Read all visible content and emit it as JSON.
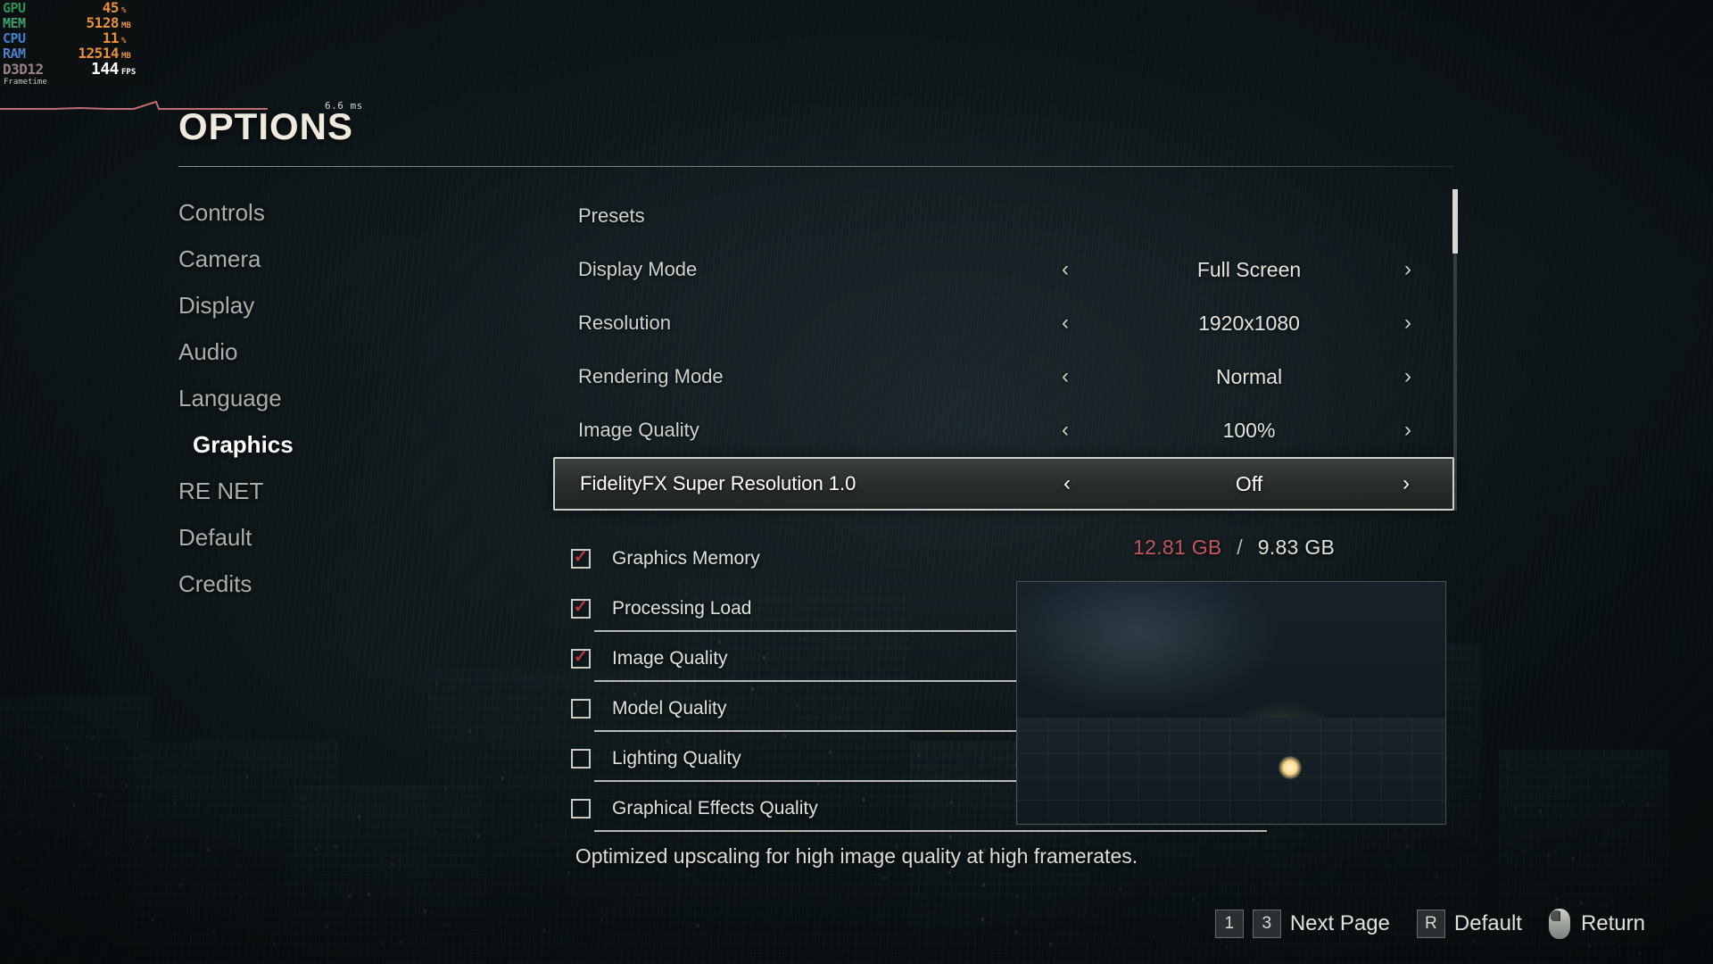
{
  "perf_overlay": {
    "rows": [
      {
        "label": "GPU",
        "value": "45",
        "unit": "%",
        "label_color": "#2f8f5b"
      },
      {
        "label": "MEM",
        "value": "5128",
        "unit": "MB",
        "label_color": "#3f9e6a"
      },
      {
        "label": "CPU",
        "value": "11",
        "unit": "%",
        "label_color": "#3f7fd0"
      },
      {
        "label": "RAM",
        "value": "12514",
        "unit": "MB",
        "label_color": "#4f7fc8"
      },
      {
        "label": "D3D12",
        "value": "144",
        "unit": "FPS",
        "label_color": "#9a7f86"
      }
    ],
    "frametime_label": "Frametime",
    "frametime_scale": "6.6 ms"
  },
  "header": {
    "title": "OPTIONS"
  },
  "sidebar": {
    "items": [
      {
        "label": "Controls",
        "selected": false
      },
      {
        "label": "Camera",
        "selected": false
      },
      {
        "label": "Display",
        "selected": false
      },
      {
        "label": "Audio",
        "selected": false
      },
      {
        "label": "Language",
        "selected": false
      },
      {
        "label": "Graphics",
        "selected": true
      },
      {
        "label": "RE NET",
        "selected": false
      },
      {
        "label": "Default",
        "selected": false
      },
      {
        "label": "Credits",
        "selected": false
      }
    ]
  },
  "settings": {
    "rows": [
      {
        "label": "Presets",
        "value": "",
        "has_arrows": false,
        "highlighted": false
      },
      {
        "label": "Display Mode",
        "value": "Full Screen",
        "has_arrows": true,
        "highlighted": false
      },
      {
        "label": "Resolution",
        "value": "1920x1080",
        "has_arrows": true,
        "highlighted": false
      },
      {
        "label": "Rendering Mode",
        "value": "Normal",
        "has_arrows": true,
        "highlighted": false
      },
      {
        "label": "Image Quality",
        "value": "100%",
        "has_arrows": true,
        "highlighted": false
      },
      {
        "label": "FidelityFX Super Resolution 1.0",
        "value": "Off",
        "has_arrows": true,
        "highlighted": true
      }
    ],
    "arrow_left": "‹",
    "arrow_right": "›"
  },
  "checkboxes": {
    "items": [
      {
        "label": "Graphics Memory",
        "checked": true,
        "has_bar": false
      },
      {
        "label": "Processing Load",
        "checked": true,
        "has_bar": true
      },
      {
        "label": "Image Quality",
        "checked": true,
        "has_bar": true
      },
      {
        "label": "Model Quality",
        "checked": false,
        "has_bar": true
      },
      {
        "label": "Lighting Quality",
        "checked": false,
        "has_bar": true
      },
      {
        "label": "Graphical Effects Quality",
        "checked": false,
        "has_bar": true
      }
    ],
    "check_glyph": "✓",
    "check_color": "#b8323c"
  },
  "memory": {
    "used": "12.81 GB",
    "separator": "/",
    "total": "9.83 GB",
    "used_color": "#c4555f"
  },
  "description": "Optimized upscaling for high image quality at high framerates.",
  "hints": [
    {
      "key": "1",
      "label": ""
    },
    {
      "key": "3",
      "label": "Next Page"
    },
    {
      "key": "R",
      "label": "Default"
    },
    {
      "key": "mouse-icon",
      "label": "Return"
    }
  ]
}
